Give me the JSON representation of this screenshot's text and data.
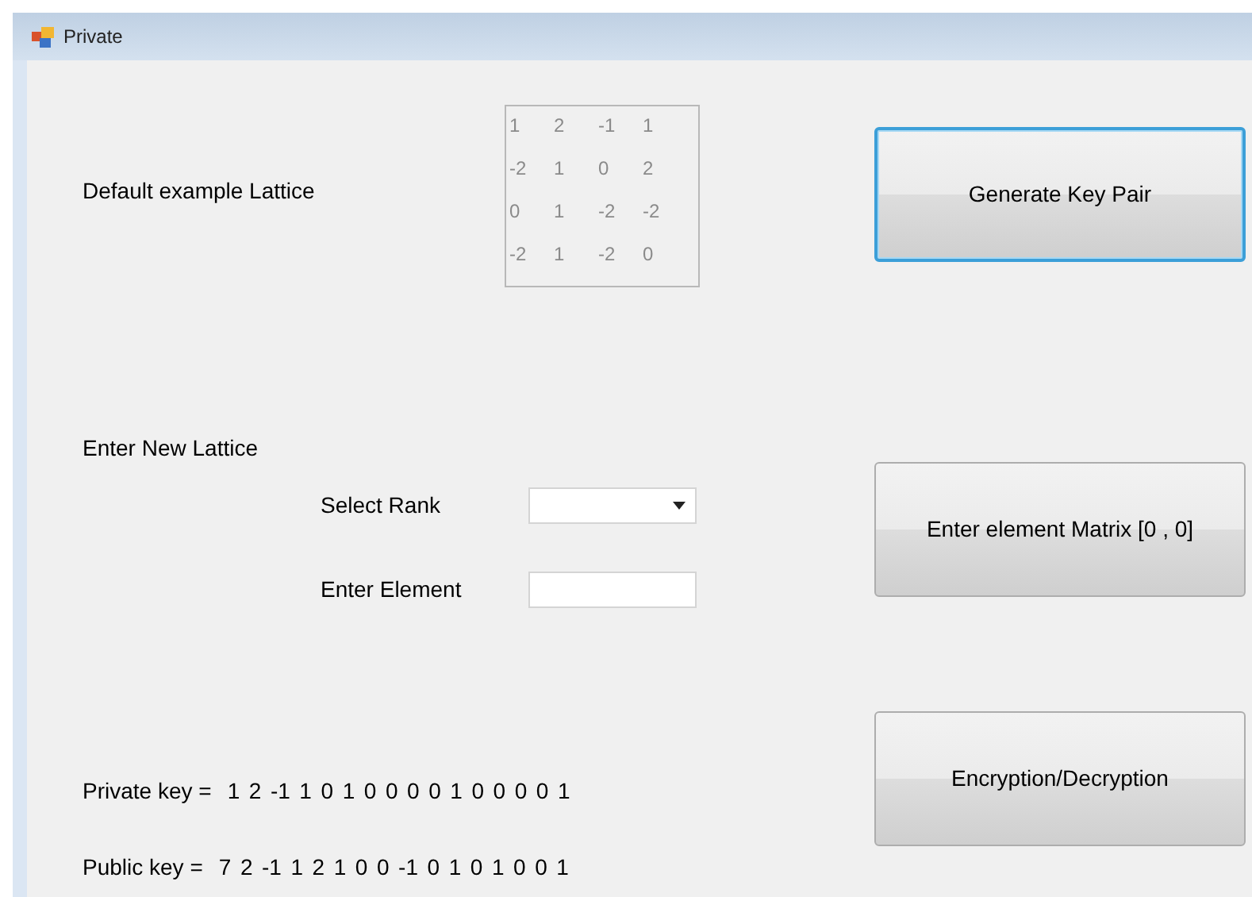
{
  "window": {
    "title": "Private"
  },
  "default_lattice": {
    "label": "Default example Lattice",
    "matrix": [
      [
        "1",
        "2",
        "-1",
        "1"
      ],
      [
        "-2",
        "1",
        "0",
        "2"
      ],
      [
        "0",
        "1",
        "-2",
        "-2"
      ],
      [
        "-2",
        "1",
        "-2",
        "0"
      ]
    ]
  },
  "new_lattice": {
    "label": "Enter New Lattice",
    "rank_label": "Select Rank",
    "element_label": "Enter Element"
  },
  "keys": [
    {
      "label": "Private key =",
      "value": "1  2  -1  1  0  1  0  0  0  0  1  0  0  0  0  1"
    },
    {
      "label": "Public key =",
      "value": "7  2  -1  1  2  1  0  0  -1  0  1  0  1  0  0  1"
    }
  ],
  "buttons": [
    {
      "label": "Generate Key Pair",
      "focused": true
    },
    {
      "label": "Enter element Matrix [0 , 0]",
      "focused": false
    },
    {
      "label": "Encryption/Decryption",
      "focused": false
    }
  ]
}
